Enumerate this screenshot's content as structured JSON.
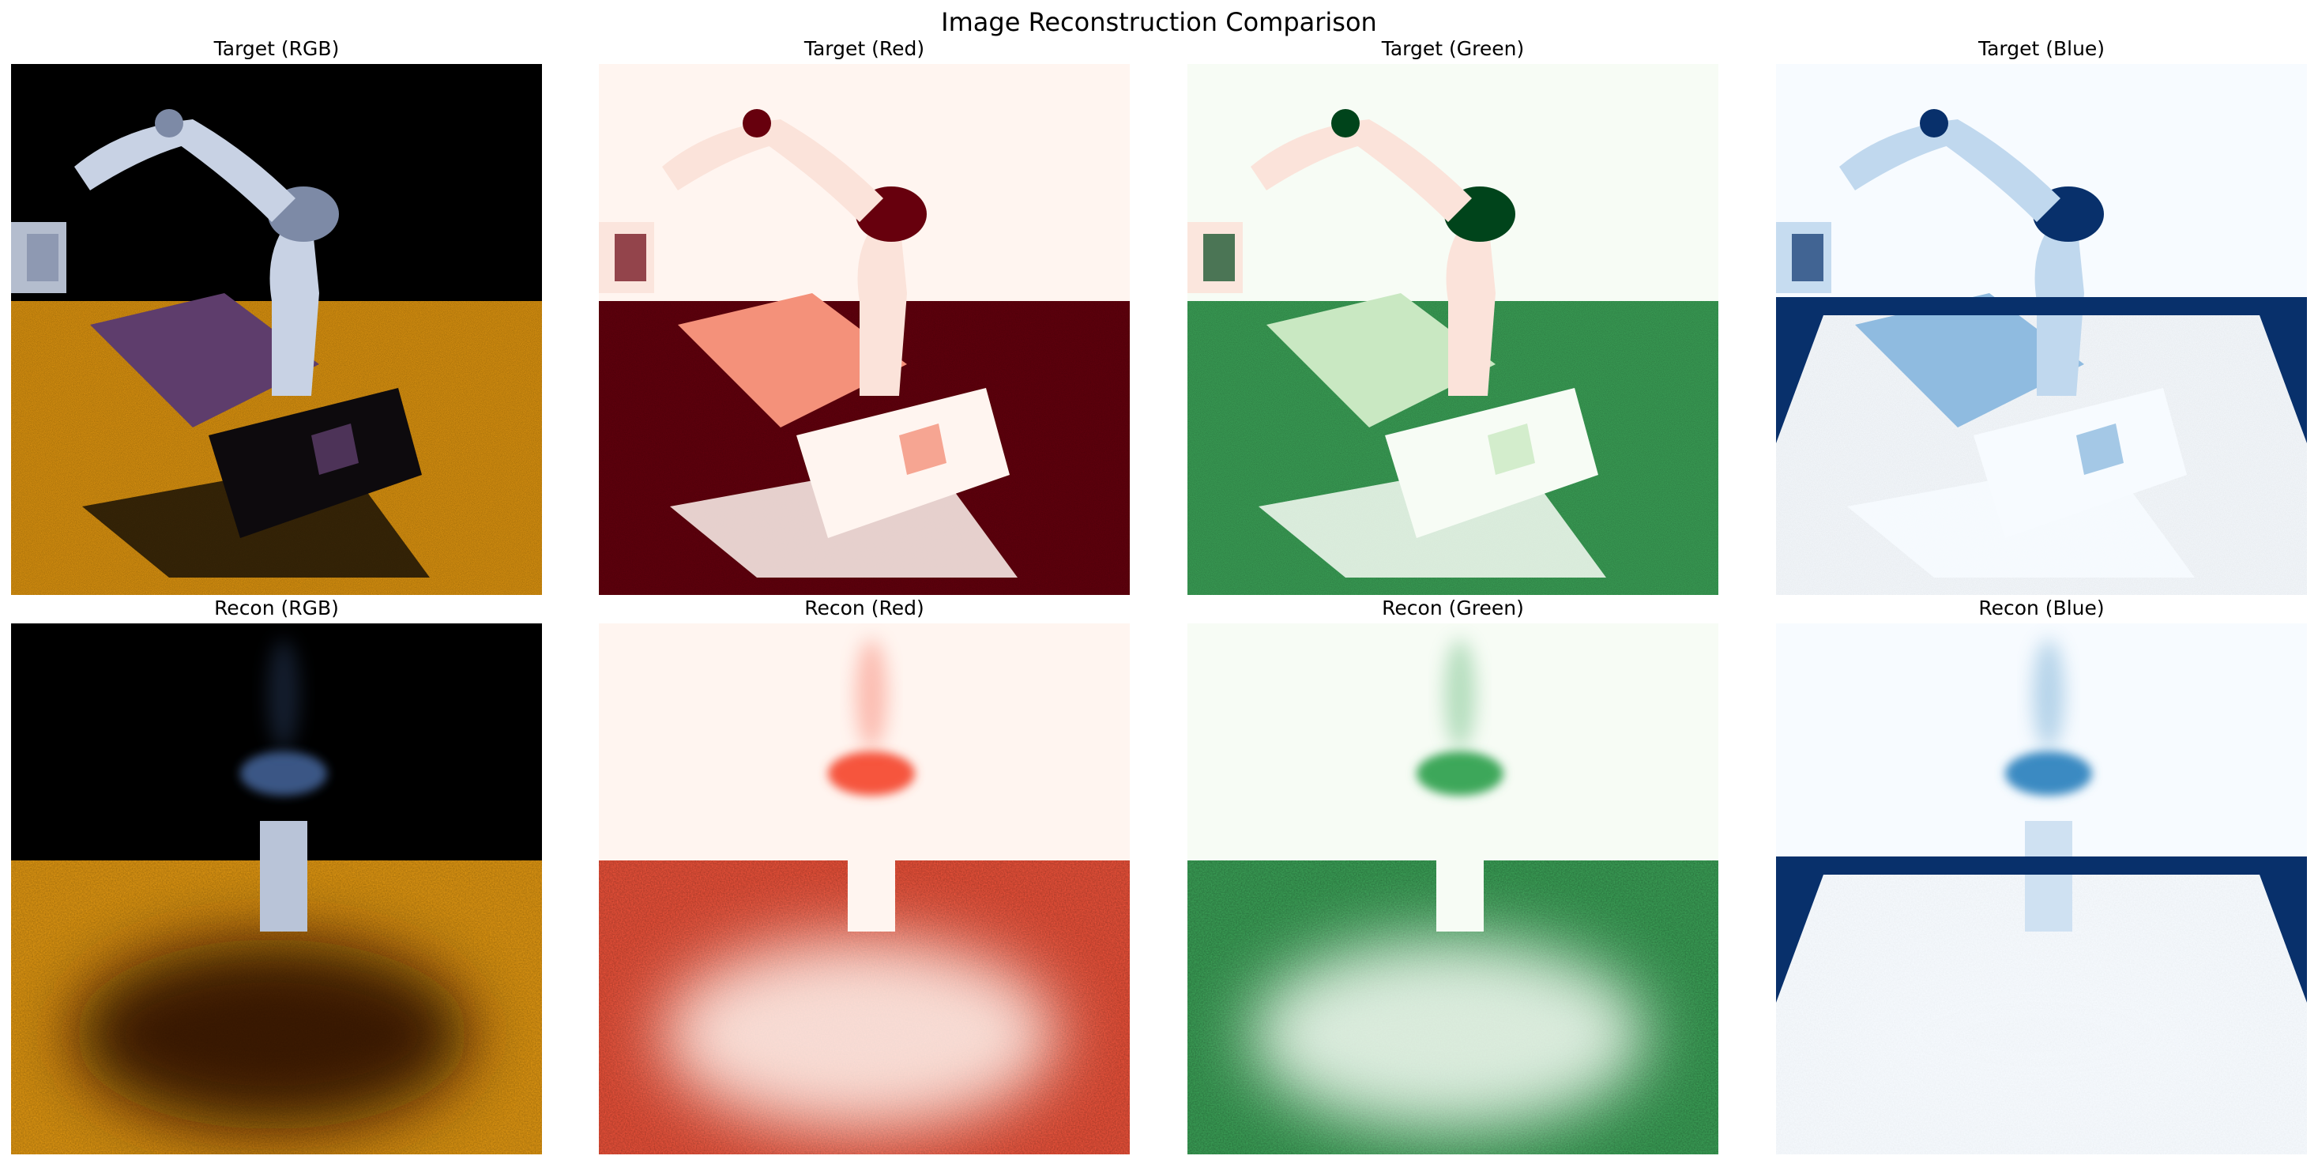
{
  "figure": {
    "title": "Image Reconstruction Comparison",
    "rows": [
      {
        "panels": [
          {
            "title": "Target (RGB)",
            "kind": "rgb",
            "variant": "target"
          },
          {
            "title": "Target (Red)",
            "kind": "channel",
            "cmap": "Reds",
            "variant": "target"
          },
          {
            "title": "Target (Green)",
            "kind": "channel",
            "cmap": "Greens",
            "variant": "target"
          },
          {
            "title": "Target (Blue)",
            "kind": "channel",
            "cmap": "Blues",
            "variant": "target"
          }
        ]
      },
      {
        "panels": [
          {
            "title": "Recon (RGB)",
            "kind": "rgb",
            "variant": "recon"
          },
          {
            "title": "Recon (Red)",
            "kind": "channel",
            "cmap": "Reds",
            "variant": "recon"
          },
          {
            "title": "Recon (Green)",
            "kind": "channel",
            "cmap": "Greens",
            "variant": "recon"
          },
          {
            "title": "Recon (Blue)",
            "kind": "channel",
            "cmap": "Blues",
            "variant": "recon"
          }
        ]
      }
    ],
    "colormaps": {
      "Reds": {
        "light": "#fff5f0",
        "mid": "#f6553c",
        "dark": "#67000d"
      },
      "Greens": {
        "light": "#f7fcf5",
        "mid": "#3da75a",
        "dark": "#00441b"
      },
      "Blues": {
        "light": "#f7fbff",
        "mid": "#3a8ac2",
        "dark": "#08306b"
      }
    }
  }
}
